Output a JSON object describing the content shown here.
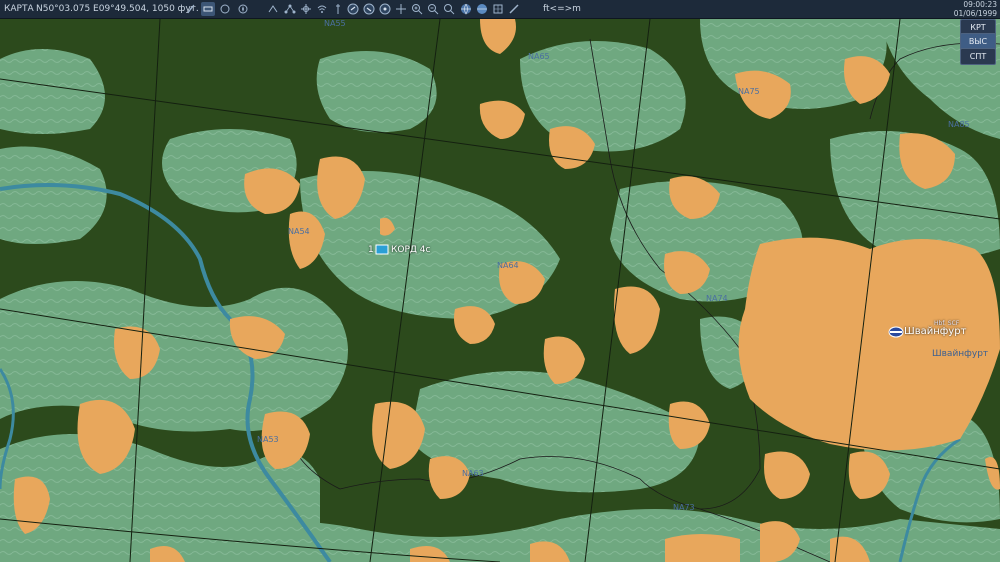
{
  "topbar": {
    "mode_label": "КАРТА",
    "coordinates": "N50°03.075 E09°49.504, 1050 фут.",
    "units_toggle": "ft<=>m",
    "time": "09:00:23",
    "date": "01/06/1999",
    "tools": [
      "cursor-icon",
      "layer-icon",
      "circle-icon",
      "compass-icon",
      "route-icon",
      "target-icon",
      "network-icon",
      "wifi-icon",
      "marker-icon",
      "vehicle-icon",
      "vehicle2-icon",
      "vehicle3-icon",
      "crosshair-icon",
      "zoom-in-icon",
      "zoom-out-icon",
      "zoom-fit-icon",
      "globe-icon",
      "globe2-icon",
      "ruler-icon"
    ]
  },
  "side_buttons": [
    "КРТ",
    "ВЫС",
    "СПТ"
  ],
  "map": {
    "colors": {
      "forest": "#2c4a1c",
      "field": "#6fa880",
      "field_light": "#8cbca0",
      "urban": "#e8a75c",
      "river": "#3d8aa0",
      "grid": "#1a2a14"
    },
    "grid_labels": [
      "NA55",
      "NA65",
      "NA75",
      "NA85",
      "NA54",
      "NA64",
      "NA74",
      "NA53",
      "NA63",
      "NA73"
    ],
    "cities": [
      {
        "name": "Швайнфурт",
        "sub": "Hbf. SCF"
      },
      {
        "name": "Швайнфурт",
        "sub": ""
      }
    ],
    "unit": {
      "number": "1",
      "name": "КОРД 4с"
    }
  }
}
